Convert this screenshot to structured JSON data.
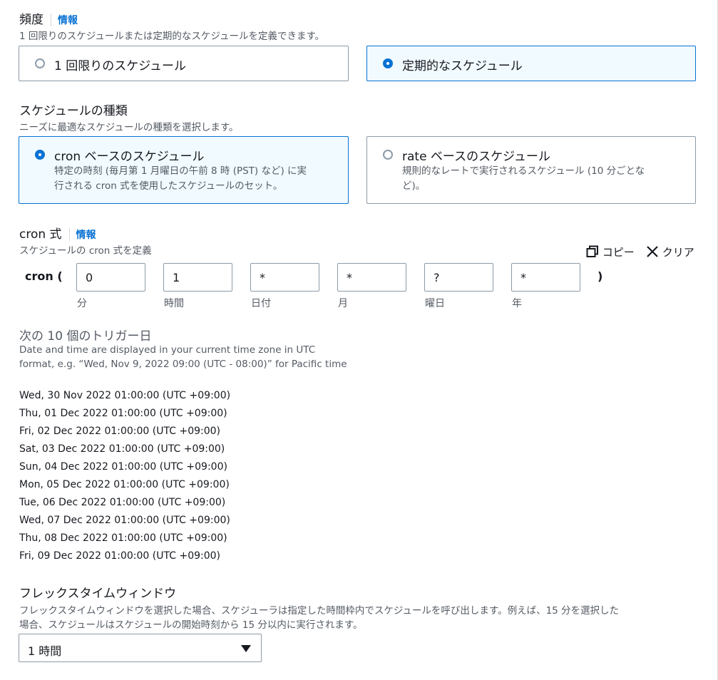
{
  "frequency": {
    "title": "頻度",
    "info": "情報",
    "description": "1 回限りのスケジュールまたは定期的なスケジュールを定義できます。",
    "options": [
      {
        "label": "1 回限りのスケジュール",
        "selected": false
      },
      {
        "label": "定期的なスケジュール",
        "selected": true
      }
    ]
  },
  "schedule_type": {
    "title": "スケジュールの種類",
    "description": "ニーズに最適なスケジュールの種類を選択します。",
    "options": [
      {
        "label": "cron ベースのスケジュール",
        "desc_line1": "特定の時刻 (毎月第 1 月曜日の午前 8 時 (PST) など) に実",
        "desc_line2": "行される cron 式を使用したスケジュールのセット。",
        "selected": true
      },
      {
        "label": "rate ベースのスケジュール",
        "desc_line1": "規則的なレートで実行されるスケジュール (10 分ごとな",
        "desc_line2": "ど)。",
        "selected": false
      }
    ]
  },
  "cron": {
    "title": "cron 式",
    "info": "情報",
    "description": "スケジュールの cron 式を定義",
    "copy_label": "コピー",
    "clear_label": "クリア",
    "open_paren": "cron (",
    "close_paren": ")",
    "fields": [
      {
        "value": "0",
        "label": "分"
      },
      {
        "value": "1",
        "label": "時間"
      },
      {
        "value": "*",
        "label": "日付"
      },
      {
        "value": "*",
        "label": "月"
      },
      {
        "value": "?",
        "label": "曜日"
      },
      {
        "value": "*",
        "label": "年"
      }
    ]
  },
  "triggers": {
    "title": "次の 10 個のトリガー日",
    "note_line1": "Date and time are displayed in your current time zone in UTC",
    "note_line2": "format, e.g. “Wed, Nov 9, 2022 09:00 (UTC - 08:00)” for Pacific time",
    "dates": [
      "Wed, 30 Nov 2022 01:00:00 (UTC +09:00)",
      "Thu, 01 Dec 2022 01:00:00 (UTC +09:00)",
      "Fri, 02 Dec 2022 01:00:00 (UTC +09:00)",
      "Sat, 03 Dec 2022 01:00:00 (UTC +09:00)",
      "Sun, 04 Dec 2022 01:00:00 (UTC +09:00)",
      "Mon, 05 Dec 2022 01:00:00 (UTC +09:00)",
      "Tue, 06 Dec 2022 01:00:00 (UTC +09:00)",
      "Wed, 07 Dec 2022 01:00:00 (UTC +09:00)",
      "Thu, 08 Dec 2022 01:00:00 (UTC +09:00)",
      "Fri, 09 Dec 2022 01:00:00 (UTC +09:00)"
    ]
  },
  "flex": {
    "title": "フレックスタイムウィンドウ",
    "description_line1": "フレックスタイムウィンドウを選択した場合、スケジューラは指定した時間枠内でスケジュールを呼び出します。例えば、15 分を選択した",
    "description_line2": "場合、スケジュールはスケジュールの開始時刻から 15 分以内に実行されます。",
    "selected": "1 時間"
  },
  "colors": {
    "accent": "#0972d3",
    "selected_bg": "#f1faff",
    "border": "#8d9ba7",
    "secondary_text": "#545b64"
  }
}
